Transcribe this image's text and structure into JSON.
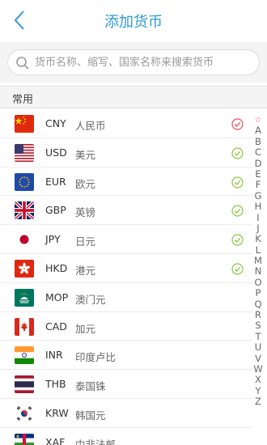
{
  "header": {
    "title": "添加货币"
  },
  "search": {
    "placeholder": "货币名称、缩写、国家名称来搜索货币"
  },
  "section": {
    "label": "常用"
  },
  "currencies": [
    {
      "code": "CNY",
      "name": "人民币",
      "flag": "cn",
      "check_color": "#e8505b"
    },
    {
      "code": "USD",
      "name": "美元",
      "flag": "us",
      "check_color": "#8cc63f"
    },
    {
      "code": "EUR",
      "name": "欧元",
      "flag": "eu",
      "check_color": "#8cc63f"
    },
    {
      "code": "GBP",
      "name": "英镑",
      "flag": "gb",
      "check_color": "#8cc63f"
    },
    {
      "code": "JPY",
      "name": "日元",
      "flag": "jp",
      "check_color": "#8cc63f"
    },
    {
      "code": "HKD",
      "name": "港元",
      "flag": "hk",
      "check_color": "#8cc63f"
    },
    {
      "code": "MOP",
      "name": "澳门元",
      "flag": "mo",
      "check_color": ""
    },
    {
      "code": "CAD",
      "name": "加元",
      "flag": "ca",
      "check_color": ""
    },
    {
      "code": "INR",
      "name": "印度卢比",
      "flag": "in",
      "check_color": ""
    },
    {
      "code": "THB",
      "name": "泰国铢",
      "flag": "th",
      "check_color": ""
    },
    {
      "code": "KRW",
      "name": "韩国元",
      "flag": "kr",
      "check_color": ""
    },
    {
      "code": "XAF",
      "name": "中非法郎",
      "flag": "cf",
      "check_color": ""
    }
  ],
  "index_letters": [
    "☆",
    "A",
    "B",
    "C",
    "D",
    "E",
    "F",
    "G",
    "H",
    "I",
    "J",
    "K",
    "L",
    "M",
    "N",
    "O",
    "P",
    "Q",
    "R",
    "S",
    "T",
    "U",
    "V",
    "W",
    "X",
    "Y",
    "Z"
  ],
  "colors": {
    "accent": "#2d9bd6",
    "selected_check": "#8cc63f",
    "current_check": "#e8505b"
  }
}
